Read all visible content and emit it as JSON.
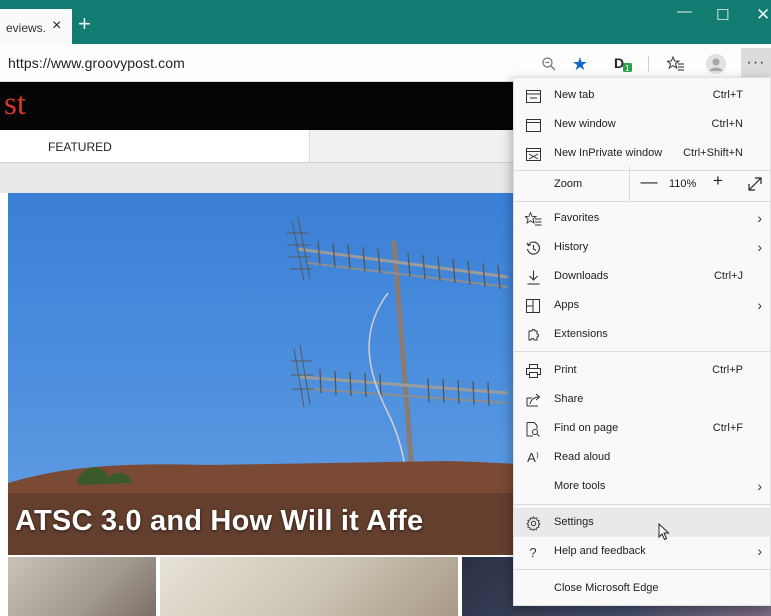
{
  "tab": {
    "title": "eviews.",
    "close": "×",
    "new_tab": "+"
  },
  "window_controls": {
    "minimize": "—",
    "maximize": "☐",
    "close": "✕"
  },
  "address_bar": {
    "url": "https://www.groovypost.com",
    "more": "···"
  },
  "page": {
    "logo_fragment": "st",
    "nav_featured": "FEATURED",
    "hero_title": "ATSC 3.0 and How Will it Affe"
  },
  "menu": {
    "items": [
      {
        "label": "New tab",
        "shortcut": "Ctrl+T",
        "icon": "new-tab-icon"
      },
      {
        "label": "New window",
        "shortcut": "Ctrl+N",
        "icon": "new-window-icon"
      },
      {
        "label": "New InPrivate window",
        "shortcut": "Ctrl+Shift+N",
        "icon": "inprivate-icon"
      }
    ],
    "zoom": {
      "label": "Zoom",
      "minus": "—",
      "value": "110%",
      "plus": "+"
    },
    "items2": [
      {
        "label": "Favorites",
        "arrow": "›",
        "icon": "favorites-icon"
      },
      {
        "label": "History",
        "arrow": "›",
        "icon": "history-icon"
      },
      {
        "label": "Downloads",
        "shortcut": "Ctrl+J",
        "icon": "download-icon"
      },
      {
        "label": "Apps",
        "arrow": "›",
        "icon": "apps-icon"
      },
      {
        "label": "Extensions",
        "icon": "extensions-icon"
      }
    ],
    "items3": [
      {
        "label": "Print",
        "shortcut": "Ctrl+P",
        "icon": "print-icon"
      },
      {
        "label": "Share",
        "icon": "share-icon"
      },
      {
        "label": "Find on page",
        "shortcut": "Ctrl+F",
        "icon": "find-icon"
      },
      {
        "label": "Read aloud",
        "icon": "read-aloud-icon",
        "glyph": "A⁾"
      },
      {
        "label": "More tools",
        "arrow": "›"
      }
    ],
    "items4": [
      {
        "label": "Settings",
        "icon": "gear-icon"
      },
      {
        "label": "Help and feedback",
        "arrow": "›",
        "icon": "help-icon",
        "glyph": "?"
      }
    ],
    "close": {
      "label": "Close Microsoft Edge"
    }
  },
  "colors": {
    "titlebar": "#127c73",
    "accent_star": "#1767c6",
    "logo_red": "#d8352b"
  }
}
